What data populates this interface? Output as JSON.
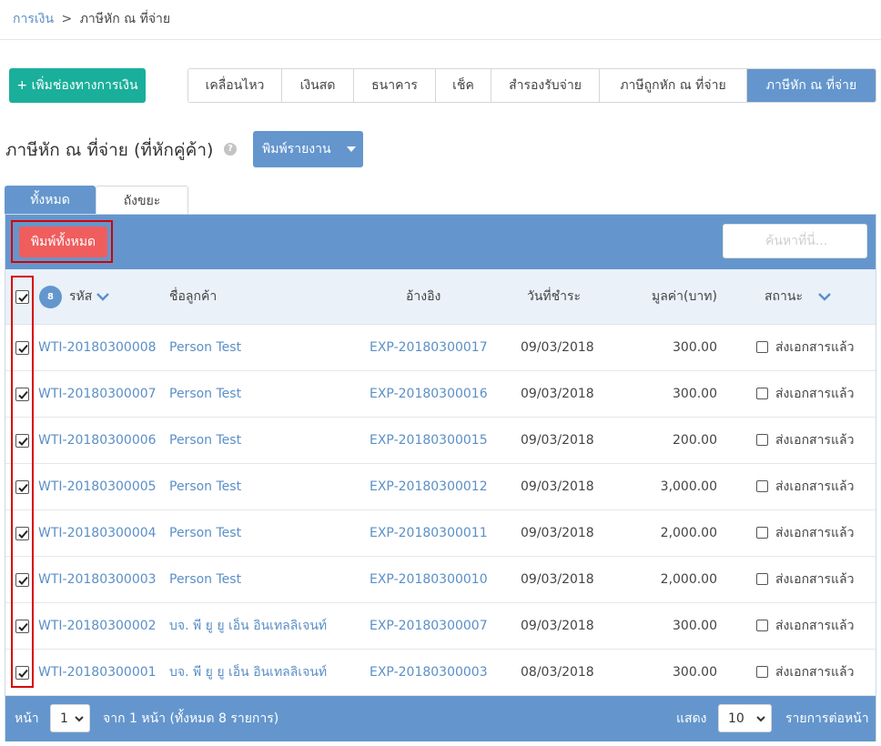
{
  "breadcrumb": {
    "root": "การเงิน",
    "separator": ">",
    "current": "ภาษีหัก ณ ที่จ่าย"
  },
  "add_channel_button": "+ เพิ่มช่องทางการเงิน",
  "tabs": [
    {
      "label": "เคลื่อนไหว",
      "active": false
    },
    {
      "label": "เงินสด",
      "active": false
    },
    {
      "label": "ธนาคาร",
      "active": false
    },
    {
      "label": "เช็ค",
      "active": false
    },
    {
      "label": "สำรองรับจ่าย",
      "active": false
    },
    {
      "label": "ภาษีถูกหัก ณ ที่จ่าย",
      "active": false
    },
    {
      "label": "ภาษีหัก ณ ที่จ่าย",
      "active": true
    }
  ],
  "page_title": "ภาษีหัก ณ ที่จ่าย (ที่หักคู่ค้า)",
  "help_icon_glyph": "?",
  "print_report_button": "พิมพ์รายงาน",
  "subtabs": {
    "all": "ทั้งหมด",
    "trash": "ถังขยะ"
  },
  "print_all_button": "พิมพ์ทั้งหมด",
  "search": {
    "placeholder": "ค้นหาที่นี่..."
  },
  "table": {
    "count": "8",
    "headers": {
      "code": "รหัส",
      "customer": "ชื่อลูกค้า",
      "reference": "อ้างอิง",
      "due_date": "วันที่ชำระ",
      "amount": "มูลค่า(บาท)",
      "status": "สถานะ"
    },
    "rows": [
      {
        "code": "WTI-20180300008",
        "customer": "Person Test",
        "reference": "EXP-20180300017",
        "date": "09/03/2018",
        "amount": "300.00",
        "status": "ส่งเอกสารแล้ว"
      },
      {
        "code": "WTI-20180300007",
        "customer": "Person Test",
        "reference": "EXP-20180300016",
        "date": "09/03/2018",
        "amount": "300.00",
        "status": "ส่งเอกสารแล้ว"
      },
      {
        "code": "WTI-20180300006",
        "customer": "Person Test",
        "reference": "EXP-20180300015",
        "date": "09/03/2018",
        "amount": "200.00",
        "status": "ส่งเอกสารแล้ว"
      },
      {
        "code": "WTI-20180300005",
        "customer": "Person Test",
        "reference": "EXP-20180300012",
        "date": "09/03/2018",
        "amount": "3,000.00",
        "status": "ส่งเอกสารแล้ว"
      },
      {
        "code": "WTI-20180300004",
        "customer": "Person Test",
        "reference": "EXP-20180300011",
        "date": "09/03/2018",
        "amount": "2,000.00",
        "status": "ส่งเอกสารแล้ว"
      },
      {
        "code": "WTI-20180300003",
        "customer": "Person Test",
        "reference": "EXP-20180300010",
        "date": "09/03/2018",
        "amount": "2,000.00",
        "status": "ส่งเอกสารแล้ว"
      },
      {
        "code": "WTI-20180300002",
        "customer": "บจ. พี ยู ยู เอ็น อินเทลลิเจนท์",
        "reference": "EXP-20180300007",
        "date": "09/03/2018",
        "amount": "300.00",
        "status": "ส่งเอกสารแล้ว"
      },
      {
        "code": "WTI-20180300001",
        "customer": "บจ. พี ยู ยู เอ็น อินเทลลิเจนท์",
        "reference": "EXP-20180300003",
        "date": "08/03/2018",
        "amount": "300.00",
        "status": "ส่งเอกสารแล้ว"
      }
    ]
  },
  "footer": {
    "page_label": "หน้า",
    "page_value": "1",
    "page_info": "จาก 1 หน้า (ทั้งหมด 8 รายการ)",
    "show_label": "แสดง",
    "per_page_value": "10",
    "per_page_label": "รายการต่อหน้า"
  },
  "colors": {
    "primary": "#6496cd",
    "teal": "#1aaf9b",
    "red": "#f05d5d",
    "link": "#5b8fc7",
    "highlight": "#d60000"
  },
  "icons": [
    "help-icon",
    "caret-down-icon",
    "chevron-down-icon",
    "check-icon"
  ]
}
